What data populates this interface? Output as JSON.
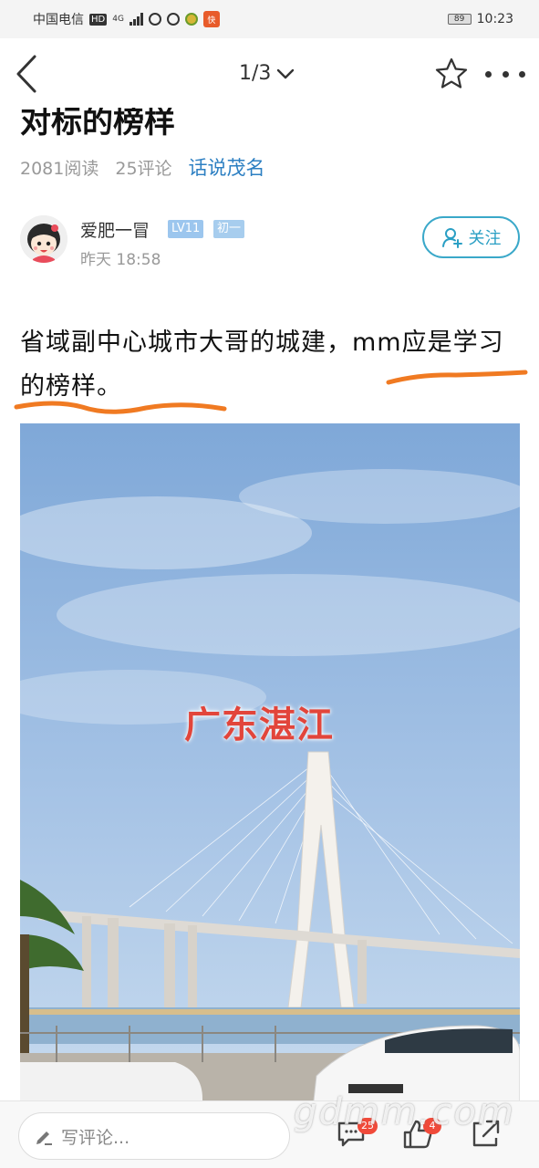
{
  "status_bar": {
    "carrier": "中国电信",
    "hd": "HD",
    "network": "4G",
    "battery": "89",
    "time": "10:23"
  },
  "nav": {
    "page_indicator": "1/3",
    "back_icon": "back-arrow-icon",
    "star_icon": "star-icon",
    "more_icon": "more-icon"
  },
  "article": {
    "title": "对标的榜样",
    "reads": "2081阅读",
    "comments": "25评论",
    "topic": "话说茂名"
  },
  "author": {
    "name": "爱肥一冒",
    "level": "LV11",
    "rank": "初一",
    "time": "昨天 18:58",
    "follow_label": "关注"
  },
  "post": {
    "text": "省域副中心城市大哥的城建，mm应是学习的榜样。",
    "image_caption": "广东湛江"
  },
  "bottom_bar": {
    "comment_placeholder": "写评论...",
    "comment_count": "25",
    "like_count": "4"
  },
  "watermark": "gdmm.com",
  "colors": {
    "accent": "#2c7fc2",
    "follow": "#3aa8c9",
    "underline": "#f07a22",
    "badge": "#f04a3a"
  }
}
